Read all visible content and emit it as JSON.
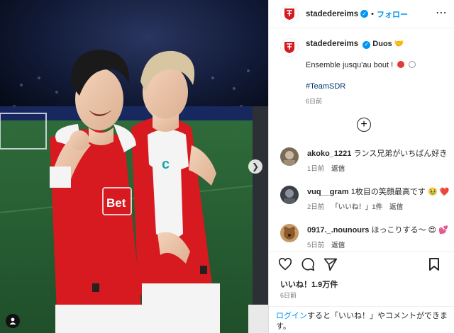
{
  "header": {
    "username": "stadedereims",
    "separator": "•",
    "follow_label": "フォロー",
    "more": "⋯"
  },
  "caption": {
    "username": "stadedereims",
    "title": "Duos",
    "text": "Ensemble jusqu'au bout !",
    "hashtag": "#TeamSDR",
    "time": "6日前"
  },
  "load_more": "+",
  "comments": [
    {
      "username": "akoko_1221",
      "text": "ランス兄弟がいちばん好き",
      "time": "1日前",
      "likes": "",
      "reply": "返信",
      "avatar_color": "#7a6a58"
    },
    {
      "username": "vuq__gram",
      "text": "1枚目の笑顔最高です 🥹 ❤️",
      "time": "2日前",
      "likes": "「いいね！」1件",
      "reply": "返信",
      "avatar_color": "#3b4048"
    },
    {
      "username": "0917._.nounours",
      "text": "ほっこりする〜 😍 💕",
      "time": "5日前",
      "likes": "",
      "reply": "返信",
      "avatar_color": "#c39a68"
    }
  ],
  "likes_label": "いいね！1.9万件",
  "post_time": "6日前",
  "login": {
    "link": "ログイン",
    "rest": "すると「いいね！」やコメントができます。"
  },
  "photo": {
    "sponsor_text": "Bet",
    "player_right_logo": "c",
    "accent_red": "#d71920"
  }
}
